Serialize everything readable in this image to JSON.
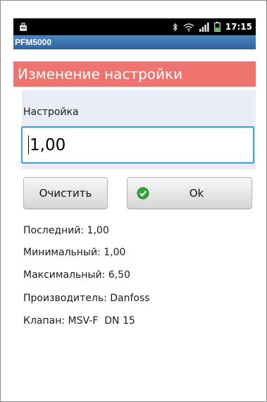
{
  "status_bar": {
    "time": "17:15",
    "icons": [
      "briefcase-icon",
      "bluetooth-icon",
      "wifi-icon",
      "signal-icon",
      "battery-icon"
    ]
  },
  "app": {
    "title": "PFM5000"
  },
  "header": {
    "title": "Изменение настройки"
  },
  "form": {
    "label": "Настройка",
    "value": "1,00"
  },
  "buttons": {
    "clear_label": "Очистить",
    "ok_label": "Ok"
  },
  "info": {
    "last": "Последний: 1,00",
    "min": "Минимальный: 1,00",
    "max": "Максимальный: 6,50",
    "manufacturer": "Производитель: Danfoss",
    "valve": "Клапан: MSV-F  DN 15"
  },
  "colors": {
    "header_bg": "#ef7470",
    "appbar_bg": "#3a6fab",
    "input_border": "#39a1d9",
    "ok_icon": "#35a43a"
  }
}
